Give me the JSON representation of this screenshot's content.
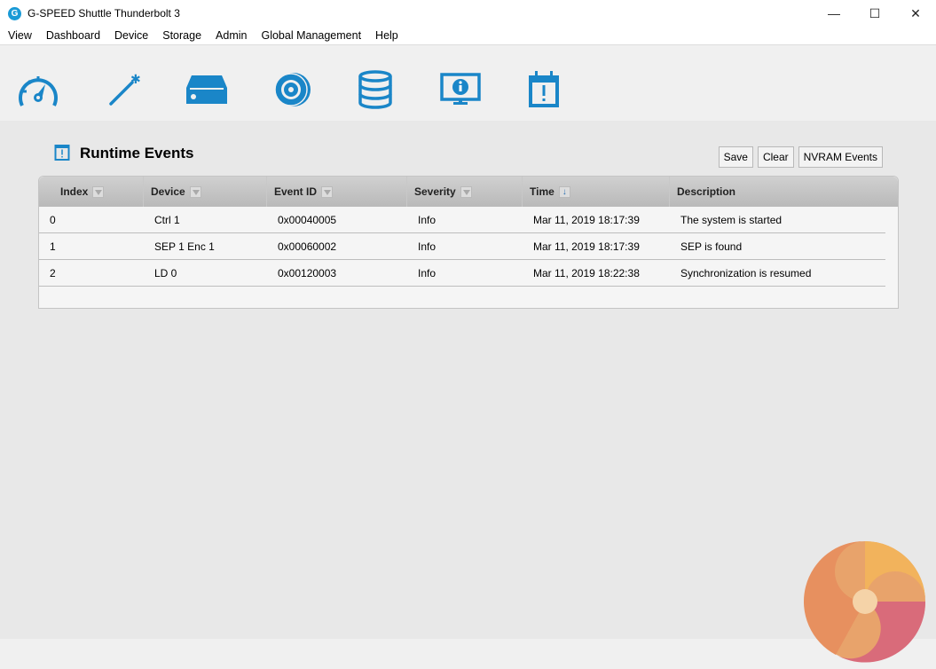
{
  "window": {
    "title": "G-SPEED Shuttle Thunderbolt 3",
    "logo": "G",
    "controls": [
      "—",
      "☐",
      "✕"
    ]
  },
  "menu": [
    "View",
    "Dashboard",
    "Device",
    "Storage",
    "Admin",
    "Global Management",
    "Help"
  ],
  "toolbar_icons": [
    "dashboard-gauge-icon",
    "wizard-wand-icon",
    "device-drive-icon",
    "storage-disk-icon",
    "database-icon",
    "info-monitor-icon",
    "events-calendar-icon"
  ],
  "panel": {
    "title": "Runtime Events",
    "buttons": {
      "save": "Save",
      "clear": "Clear",
      "nvram": "NVRAM Events"
    }
  },
  "table": {
    "columns": [
      "Index",
      "Device",
      "Event ID",
      "Severity",
      "Time",
      "Description"
    ],
    "rows": [
      [
        "0",
        "Ctrl 1",
        "0x00040005",
        "Info",
        "Mar 11, 2019 18:17:39",
        "The system is started"
      ],
      [
        "1",
        "SEP 1 Enc 1",
        "0x00060002",
        "Info",
        "Mar 11, 2019 18:17:39",
        "SEP is found"
      ],
      [
        "2",
        "LD 0",
        "0x00120003",
        "Info",
        "Mar 11, 2019 18:22:38",
        "Synchronization is resumed"
      ]
    ]
  },
  "colors": {
    "accent": "#1a86c8"
  }
}
